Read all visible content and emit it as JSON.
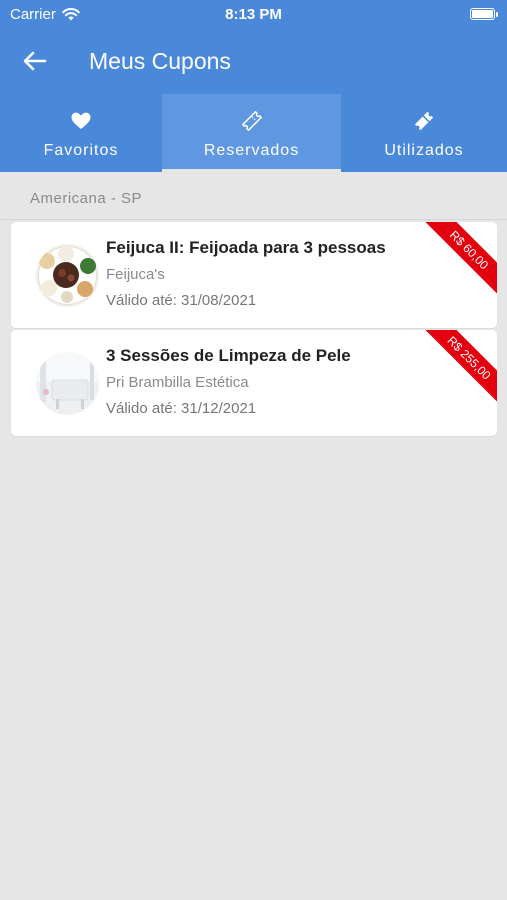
{
  "status_bar": {
    "carrier": "Carrier",
    "time": "8:13 PM"
  },
  "header": {
    "title": "Meus Cupons"
  },
  "tabs": [
    {
      "label": "Favoritos",
      "icon": "heart-icon",
      "active": false
    },
    {
      "label": "Reservados",
      "icon": "ticket-icon",
      "active": true
    },
    {
      "label": "Utilizados",
      "icon": "used-ticket-icon",
      "active": false
    }
  ],
  "location": "Americana - SP",
  "coupons": [
    {
      "title": "Feijuca II: Feijoada para 3 pessoas",
      "merchant": "Feijuca's",
      "valid": "Válido até: 31/08/2021",
      "price": "R$ 60,00"
    },
    {
      "title": "3 Sessões de Limpeza de Pele",
      "merchant": "Pri Brambilla Estética",
      "valid": "Válido até: 31/12/2021",
      "price": "R$ 255,00"
    }
  ],
  "colors": {
    "primary": "#4a88d9",
    "active_tab": "#5f97e0",
    "ribbon": "#e3000f",
    "background": "#e6e6e6"
  }
}
